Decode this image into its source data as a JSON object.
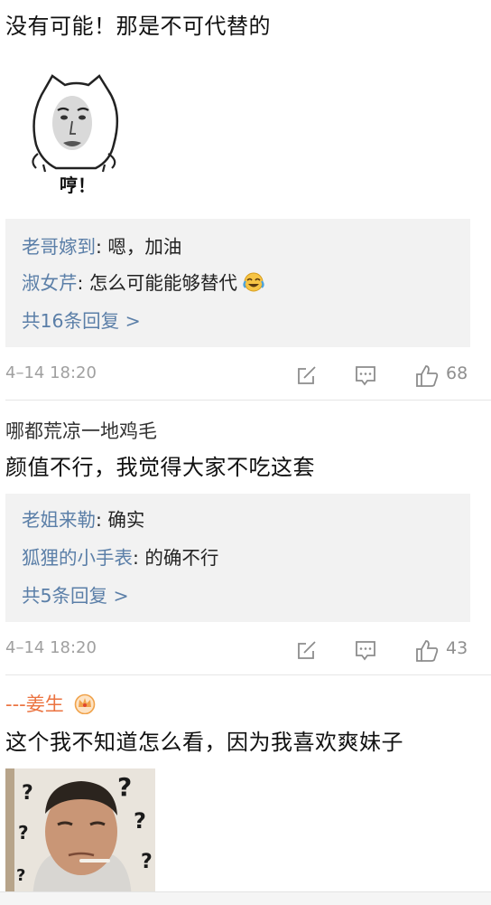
{
  "comment1": {
    "text": "没有可能！那是不可代替的",
    "sticker_text": "哼！",
    "replies": [
      {
        "user": "老哥嫁到",
        "text": ": 嗯，加油",
        "emoji": ""
      },
      {
        "user": "淑女芹",
        "text": ": 怎么可能能够替代",
        "emoji": "laugh-cry-emoji"
      }
    ],
    "more_replies": "共16条回复 >",
    "time": "4–14 18:20",
    "likes": "68"
  },
  "comment2": {
    "author": "哪都荒凉一地鸡毛",
    "text": "颜值不行，我觉得大家不吃这套",
    "replies": [
      {
        "user": "老姐来勒",
        "text": ": 确实"
      },
      {
        "user": "狐狸的小手表",
        "text": ": 的确不行"
      }
    ],
    "more_replies": "共5条回复 >",
    "time": "4–14 18:20",
    "likes": "43"
  },
  "comment3": {
    "author": "---姜生",
    "badge_icon": "crown-badge-icon",
    "text": "这个我不知道怎么看，因为我喜欢爽妹子",
    "image_icon": "thinking-man-photo"
  },
  "colors": {
    "link": "#5b7fa8",
    "orange_name": "#eb7340",
    "reply_bg": "#f2f2f2",
    "meta_gray": "#a0a0a0"
  }
}
